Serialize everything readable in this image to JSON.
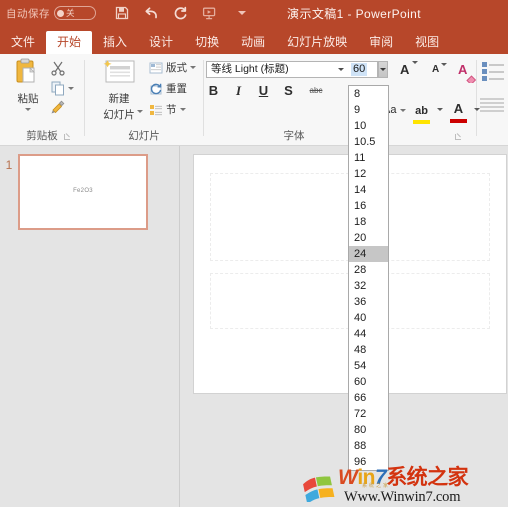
{
  "titlebar": {
    "autosave_label": "自动保存",
    "autosave_state": "关",
    "document_title": "演示文稿1  -  PowerPoint",
    "quick_access": [
      {
        "name": "save-icon",
        "label": "保存"
      },
      {
        "name": "undo-icon",
        "label": "撤消"
      },
      {
        "name": "redo-icon",
        "label": "重复"
      },
      {
        "name": "start-slideshow-icon",
        "label": "从头开始"
      },
      {
        "name": "customize-quick-access-caret",
        "label": "自定义快速访问工具栏"
      }
    ],
    "accent_color": "#b7472a"
  },
  "tabs": [
    {
      "label": "文件",
      "active": false
    },
    {
      "label": "开始",
      "active": true
    },
    {
      "label": "插入",
      "active": false
    },
    {
      "label": "设计",
      "active": false
    },
    {
      "label": "切换",
      "active": false
    },
    {
      "label": "动画",
      "active": false
    },
    {
      "label": "幻灯片放映",
      "active": false
    },
    {
      "label": "审阅",
      "active": false
    },
    {
      "label": "视图",
      "active": false
    }
  ],
  "ribbon": {
    "clipboard": {
      "group_label": "剪贴板",
      "paste_label": "粘贴",
      "cut_label": "剪切",
      "copy_label": "复制",
      "format_painter_label": "格式刷"
    },
    "slides": {
      "group_label": "幻灯片",
      "new_slide_line1": "新建",
      "new_slide_line2": "幻灯片",
      "layout_label": "版式",
      "reset_label": "重置",
      "section_label": "节"
    },
    "font": {
      "group_label": "字体",
      "font_name_value": "等线 Light (标题)",
      "font_size_value": "60",
      "bold": "B",
      "italic": "I",
      "underline": "U",
      "shadow": "S",
      "strikethrough": "abc",
      "grow_font": "A",
      "shrink_font": "A",
      "clear_formatting": "A",
      "change_case": "Aa",
      "highlight_glyph": "ab",
      "font_color_glyph": "A",
      "highlight_color": "#ffe400",
      "font_color": "#cc0000"
    }
  },
  "font_size_dropdown": {
    "options": [
      "8",
      "9",
      "10",
      "10.5",
      "11",
      "12",
      "14",
      "16",
      "18",
      "20",
      "24",
      "28",
      "32",
      "36",
      "40",
      "44",
      "48",
      "54",
      "60",
      "66",
      "72",
      "80",
      "88",
      "96"
    ],
    "selected": "24"
  },
  "thumbnails": [
    {
      "number": "1",
      "text": "Fe2O3"
    }
  ],
  "watermark": {
    "brand_w": "W",
    "brand_in": "in",
    "brand_7": "7",
    "brand_cn": "系统之家",
    "sub": "系统之家",
    "url": "Www.Winwin7.com"
  }
}
